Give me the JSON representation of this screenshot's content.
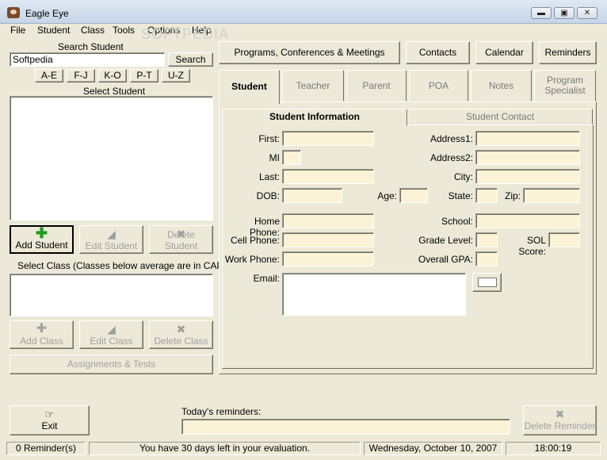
{
  "window": {
    "title": "Eagle Eye",
    "minimize": "▬",
    "maximize": "▣",
    "close": "✕"
  },
  "watermark": "SOFTPEDIA",
  "menu": [
    "File",
    "Student",
    "Class",
    "Tools",
    "Options",
    "Help"
  ],
  "left": {
    "search_label": "Search Student",
    "search_value": "Softpedia",
    "search_button": "Search",
    "ranges": [
      "A-E",
      "F-J",
      "K-O",
      "P-T",
      "U-Z"
    ],
    "select_student_label": "Select Student",
    "add_student": "Add Student",
    "edit_student": "Edit Student",
    "delete_student": "Delete Student",
    "select_class_label": "Select Class (Classes below average are in CAPS)",
    "add_class": "Add Class",
    "edit_class": "Edit Class",
    "delete_class": "Delete Class",
    "assignments": "Assignments & Tests"
  },
  "top_buttons": {
    "programs": "Programs, Conferences & Meetings",
    "contacts": "Contacts",
    "calendar": "Calendar",
    "reminders": "Reminders"
  },
  "tabs": [
    "Student",
    "Teacher",
    "Parent",
    "POA",
    "Notes",
    "Program",
    "Specialist"
  ],
  "subtabs": {
    "info": "Student Information",
    "contact": "Student Contact"
  },
  "form": {
    "first": "First:",
    "mi": "MI",
    "last": "Last:",
    "dob": "DOB:",
    "age": "Age:",
    "home_phone": "Home Phone:",
    "cell_phone": "Cell Phone:",
    "work_phone": "Work Phone:",
    "email": "Email:",
    "address1": "Address1:",
    "address2": "Address2:",
    "city": "City:",
    "state": "State:",
    "zip": "Zip:",
    "school": "School:",
    "grade_level": "Grade Level:",
    "sol_score": "SOL Score:",
    "overall_gpa": "Overall GPA:"
  },
  "bottom": {
    "exit": "Exit",
    "todays_reminders": "Today's reminders:",
    "delete_reminder": "Delete Reminder"
  },
  "status": {
    "reminders": "0 Reminder(s)",
    "evaluation": "You have 30 days left in your evaluation.",
    "date": "Wednesday, October 10, 2007",
    "time": "18:00:19"
  }
}
